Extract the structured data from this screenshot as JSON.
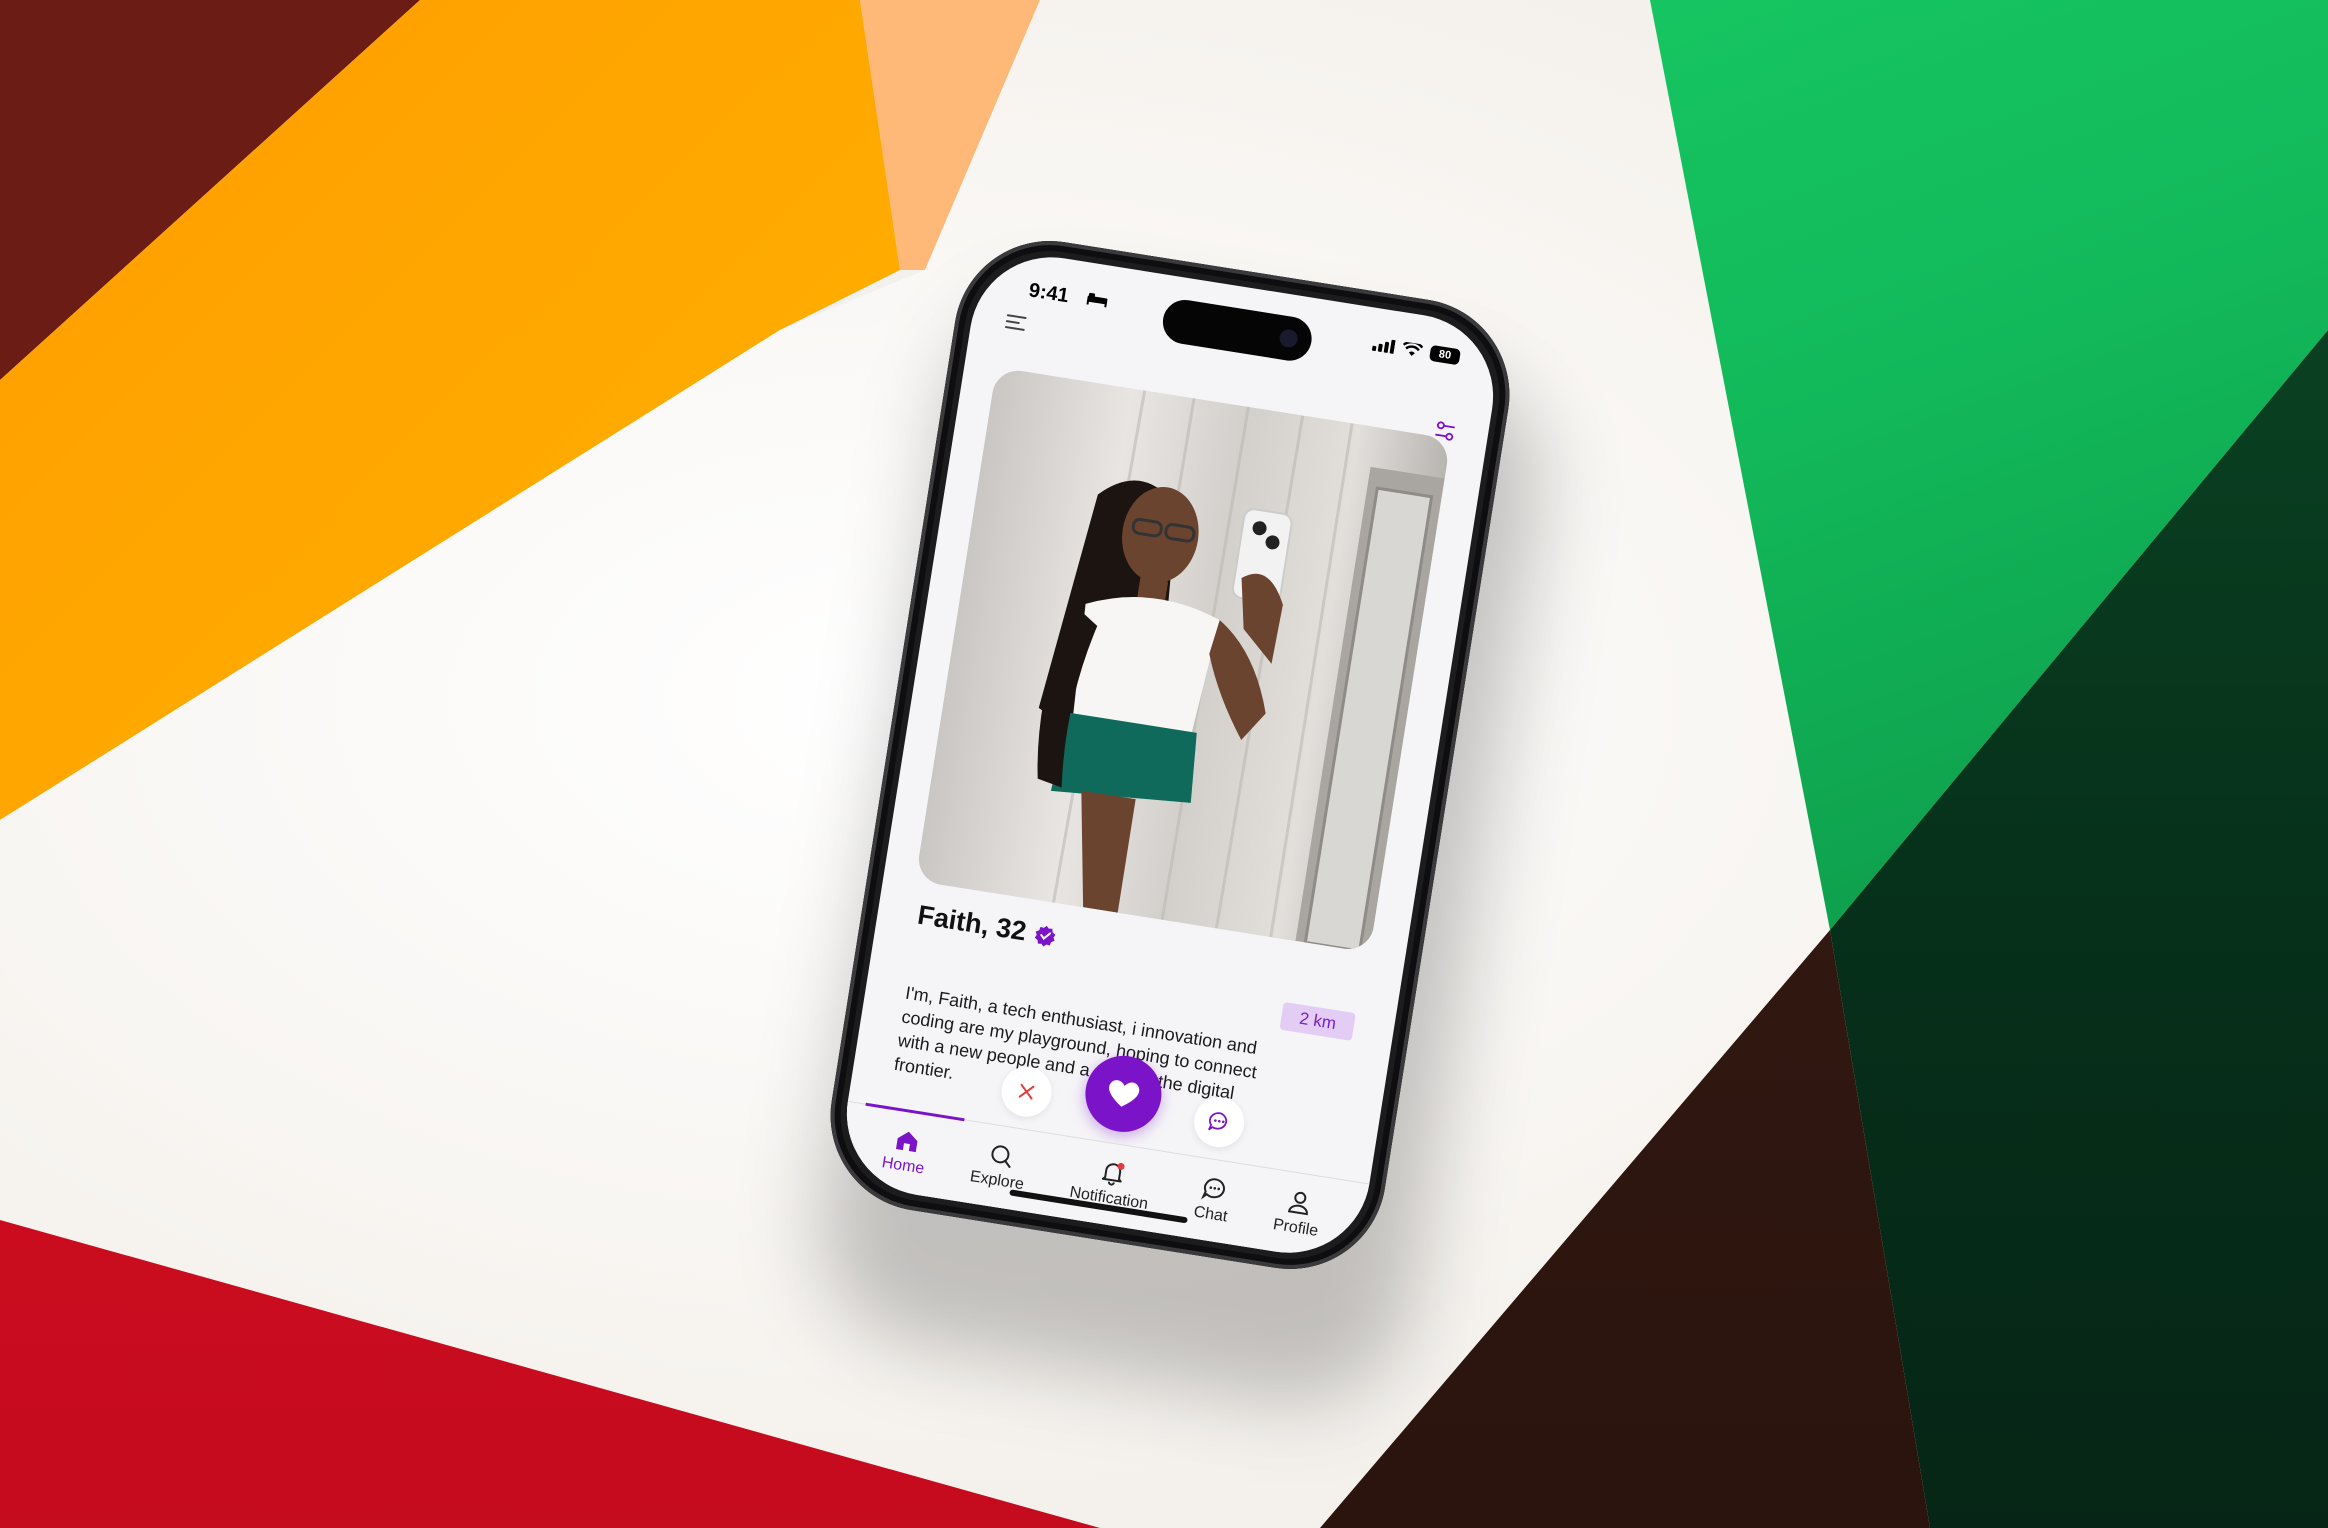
{
  "status_bar": {
    "time": "9:41",
    "battery": "80"
  },
  "profile": {
    "name": "Faith, 32",
    "distance": "2 km",
    "bio": "I'm, Faith, a tech enthusiast, i innovation and coding are my playground, hoping to connect with a new people and a explore the digital frontier."
  },
  "tabs": [
    {
      "label": "Home",
      "icon": "home-icon",
      "active": true
    },
    {
      "label": "Explore",
      "icon": "search-icon",
      "active": false
    },
    {
      "label": "Notification",
      "icon": "bell-icon",
      "active": false
    },
    {
      "label": "Chat",
      "icon": "chat-bubble-icon",
      "active": false
    },
    {
      "label": "Profile",
      "icon": "user-icon",
      "active": false
    }
  ],
  "colors": {
    "accent": "#7b14c9",
    "distance_badge_bg": "#e3cdf5",
    "reject": "#e23b3b",
    "notification_dot": "#e23b3b"
  }
}
